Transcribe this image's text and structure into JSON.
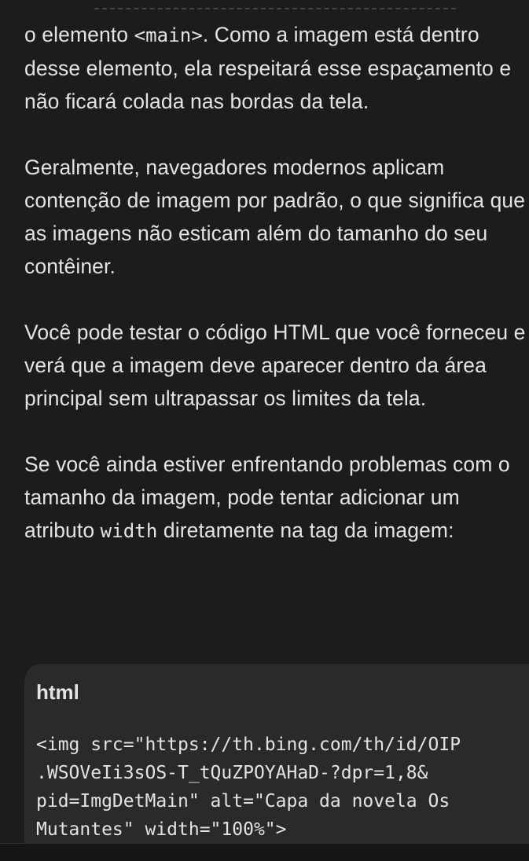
{
  "message": {
    "paragraphs": [
      {
        "before": "o elemento ",
        "code": "<main>",
        "after": ". Como a imagem está dentro desse elemento, ela respeitará esse espaçamento e não ficará colada nas bordas da tela."
      },
      {
        "before": "Geralmente, navegadores modernos aplicam contenção de imagem por padrão, o que significa que as imagens não esticam além do tamanho do seu contêiner.",
        "code": "",
        "after": ""
      },
      {
        "before": "Você pode testar o código HTML que você forneceu e verá que a imagem deve aparecer dentro da área principal sem ultrapassar os limites da tela.",
        "code": "",
        "after": ""
      },
      {
        "before": "Se você ainda estiver enfrentando problemas com o tamanho da imagem, pode tentar adicionar um atributo ",
        "code": "width",
        "after": " diretamente na tag da imagem:"
      }
    ],
    "code_block": {
      "language": "html",
      "code": "<img src=\"https://th.bing.com/th/id/OIP\n.WSOVeIi3sOS-T_tQuZPOYAHaD-?dpr=1,8&\npid=ImgDetMain\" alt=\"Capa da novela Os\nMutantes\" width=\"100%\">"
    }
  }
}
